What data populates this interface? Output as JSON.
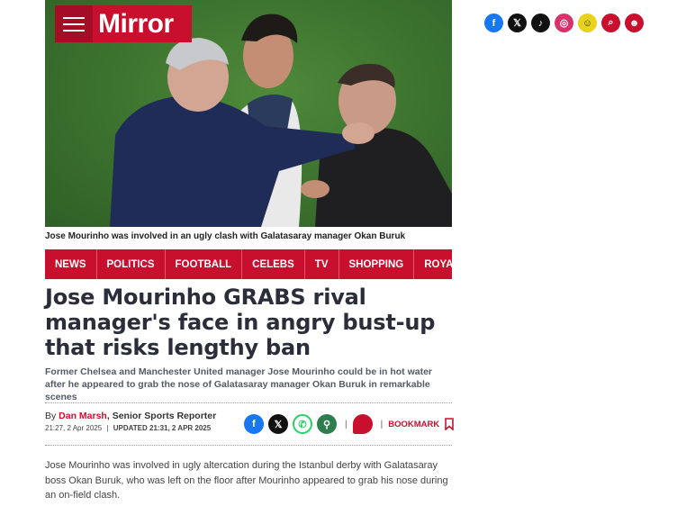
{
  "brand": {
    "logo_text": "Mirror",
    "color": "#c8102e"
  },
  "hero": {
    "caption": "Jose Mourinho was involved in an ugly clash with Galatasaray manager Okan Buruk"
  },
  "nav": {
    "items": [
      "NEWS",
      "POLITICS",
      "FOOTBALL",
      "CELEBS",
      "TV",
      "SHOPPING",
      "ROYALS"
    ]
  },
  "article": {
    "headline": "Jose Mourinho GRABS rival manager's face in angry bust-up that risks lengthy ban",
    "standfirst": "Former Chelsea and Manchester United manager Jose Mourinho could be in hot water after he appeared to grab the nose of Galatasaray manager Okan Buruk in remarkable scenes",
    "byline": {
      "prefix": "By ",
      "author": "Dan Marsh",
      "role": ", Senior Sports Reporter"
    },
    "published": "21:27, 2 Apr 2025",
    "updated": "UPDATED 21:31, 2 APR 2025",
    "bookmark_label": "BOOKMARK",
    "body": "Jose Mourinho was involved in ugly altercation during the Istanbul derby with Galatasaray boss Okan Buruk, who was left on the floor after Mourinho appeared to grab his nose during an on-field clash."
  },
  "share_icons": [
    "facebook-icon",
    "x-icon",
    "whatsapp-icon",
    "link-icon",
    "comment-icon",
    "bookmark-icon"
  ],
  "social_icons": [
    "facebook-icon",
    "x-icon",
    "tiktok-icon",
    "instagram-icon",
    "snapchat-icon",
    "search-icon",
    "avatar-icon"
  ]
}
